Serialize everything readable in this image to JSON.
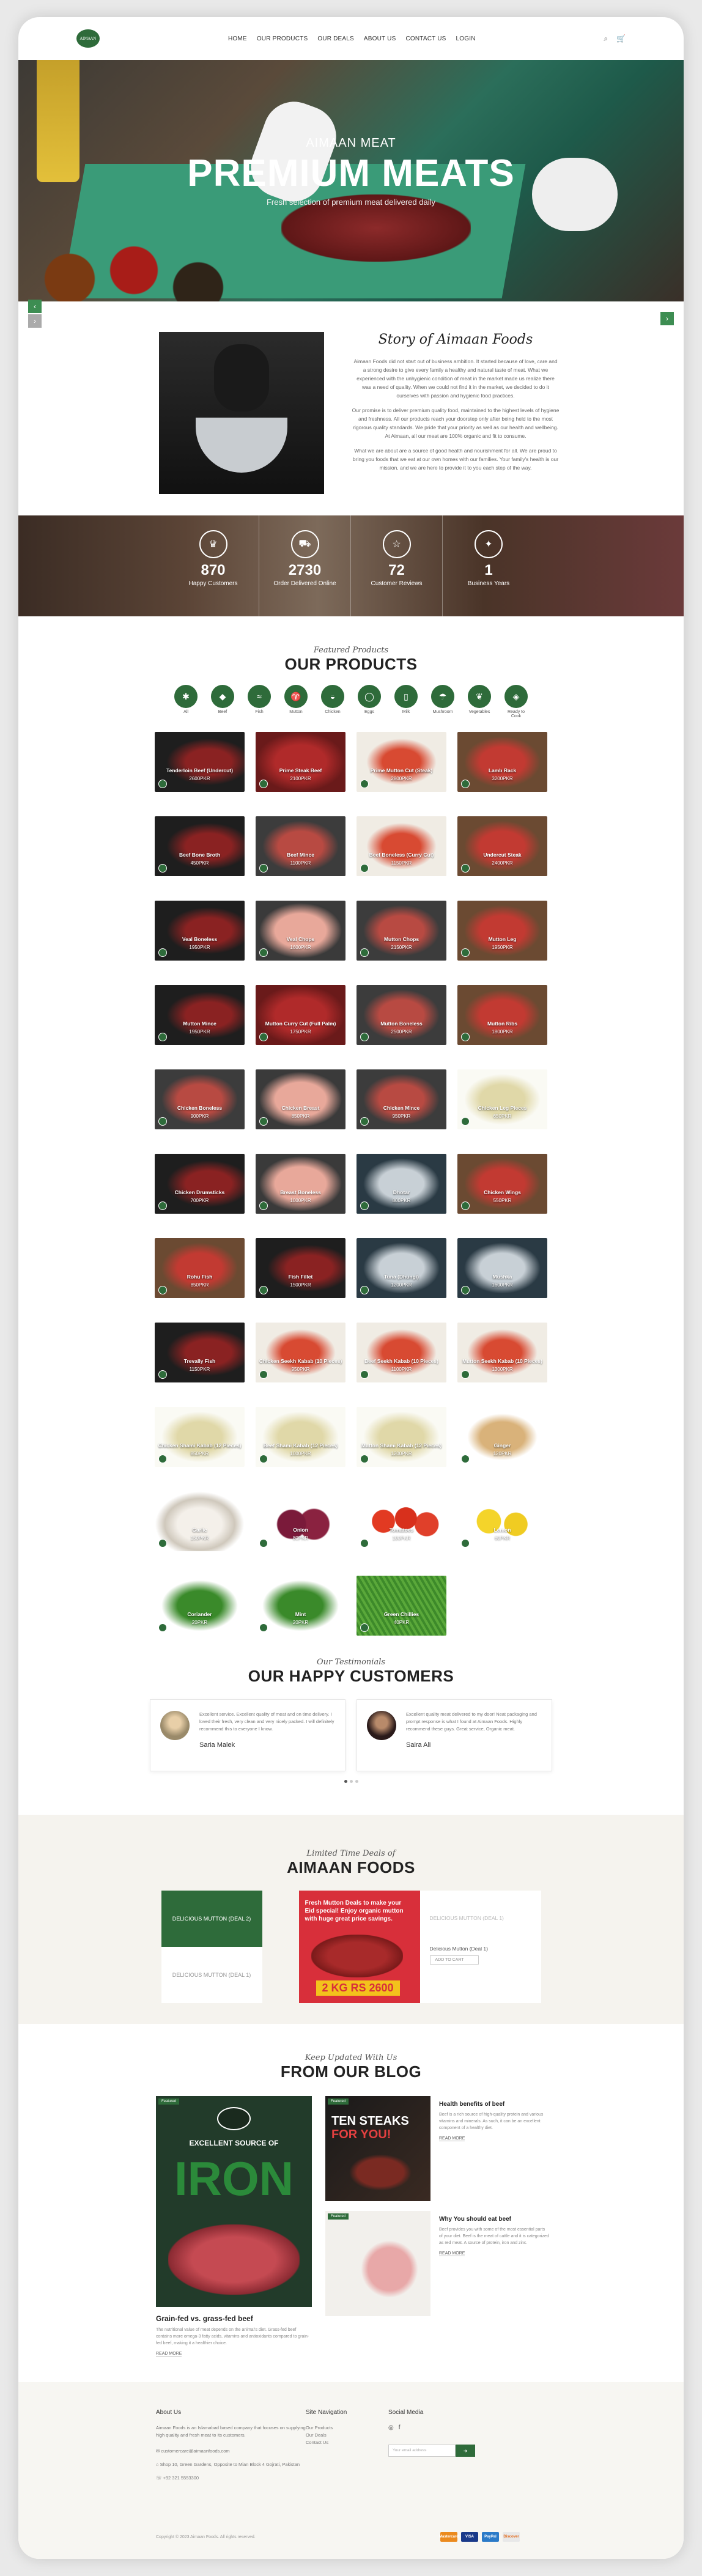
{
  "header": {
    "nav": [
      "HOME",
      "OUR PRODUCTS",
      "OUR DEALS",
      "ABOUT US",
      "CONTACT US",
      "LOGIN"
    ],
    "icons": [
      "search-icon",
      "cart-icon"
    ]
  },
  "hero": {
    "subtitle": "AIMAAN MEAT",
    "title": "PREMIUM MEATS",
    "tagline": "Fresh selection of premium meat delivered daily"
  },
  "story": {
    "title": "Story of Aimaan Foods",
    "paragraphs": [
      "Aimaan Foods did not start out of business ambition. It started because of love, care and a strong desire to give every family a healthy and natural taste of meat. What we experienced with the unhygienic condition of meat in the market made us realize there was a need of quality. When we could not find it in the market, we decided to do it ourselves with passion and hygienic food practices.",
      "Our promise is to deliver premium quality food, maintained to the highest levels of hygiene and freshness. All our products reach your doorstep only after being held to the most rigorous quality standards. We pride that your priority as well as our health and wellbeing. At Aimaan, all our meat are 100% organic and fit to consume.",
      "What we are about are a source of good health and nourishment for all. We are proud to bring you foods that we eat at our own homes with our families. Your family's health is our mission, and we are here to provide it to you each step of the way."
    ]
  },
  "stats": [
    {
      "icon": "crown-icon",
      "number": "870",
      "label": "Happy Customers"
    },
    {
      "icon": "truck-icon",
      "number": "2730",
      "label": "Order Delivered Online"
    },
    {
      "icon": "star-icon",
      "number": "72",
      "label": "Customer Reviews"
    },
    {
      "icon": "trophy-icon",
      "number": "1",
      "label": "Business Years"
    }
  ],
  "products": {
    "script": "Featured Products",
    "title": "OUR PRODUCTS",
    "categories": [
      "All",
      "Beef",
      "Fish",
      "Mutton",
      "Chicken",
      "Eggs",
      "Milk",
      "Mushroom",
      "Vegetables",
      "Ready to Cook"
    ],
    "items": [
      {
        "name": "Tenderloin Beef (Undercut)",
        "price": "2600PKR",
        "bg": "bg-dark"
      },
      {
        "name": "Prime Steak Beef",
        "price": "2100PKR",
        "bg": "bg-red"
      },
      {
        "name": "Prime Mutton Cut (Steak)",
        "price": "2800PKR",
        "bg": "bg-light"
      },
      {
        "name": "Lamb Rack",
        "price": "3200PKR",
        "bg": "bg-wood"
      },
      {
        "name": "Beef Bone Broth",
        "price": "450PKR",
        "bg": "bg-dark"
      },
      {
        "name": "Beef Mince",
        "price": "1100PKR",
        "bg": "bg-gray"
      },
      {
        "name": "Beef Boneless (Curry Cut)",
        "price": "1150PKR",
        "bg": "bg-light"
      },
      {
        "name": "Undercut Steak",
        "price": "2400PKR",
        "bg": "bg-wood"
      },
      {
        "name": "Veal Boneless",
        "price": "1950PKR",
        "bg": "bg-dark"
      },
      {
        "name": "Veal Chops",
        "price": "1600PKR",
        "bg": "bg-pink"
      },
      {
        "name": "Mutton Chops",
        "price": "2150PKR",
        "bg": "bg-gray"
      },
      {
        "name": "Mutton Leg",
        "price": "1950PKR",
        "bg": "bg-wood"
      },
      {
        "name": "Mutton Mince",
        "price": "1950PKR",
        "bg": "bg-dark"
      },
      {
        "name": "Mutton Curry Cut (Full Palm)",
        "price": "1750PKR",
        "bg": "bg-red"
      },
      {
        "name": "Mutton Boneless",
        "price": "2500PKR",
        "bg": "bg-gray"
      },
      {
        "name": "Mutton Ribs",
        "price": "1800PKR",
        "bg": "bg-wood"
      },
      {
        "name": "Chicken Boneless",
        "price": "900PKR",
        "bg": "bg-gray"
      },
      {
        "name": "Chicken Breast",
        "price": "850PKR",
        "bg": "bg-pink"
      },
      {
        "name": "Chicken Mince",
        "price": "950PKR",
        "bg": "bg-gray"
      },
      {
        "name": "Chicken Leg Pieces",
        "price": "650PKR",
        "bg": "bg-veg"
      },
      {
        "name": "Chicken Drumsticks",
        "price": "700PKR",
        "bg": "bg-dark"
      },
      {
        "name": "Breast Boneless",
        "price": "1000PKR",
        "bg": "bg-pink"
      },
      {
        "name": "Dhotar",
        "price": "800PKR",
        "bg": "bg-fish"
      },
      {
        "name": "Chicken Wings",
        "price": "550PKR",
        "bg": "bg-wood"
      },
      {
        "name": "Rohu Fish",
        "price": "850PKR",
        "bg": "bg-wood"
      },
      {
        "name": "Fish Fillet",
        "price": "1500PKR",
        "bg": "bg-dark"
      },
      {
        "name": "Tuna (Dhungi)",
        "price": "1200PKR",
        "bg": "bg-fish"
      },
      {
        "name": "Mushka",
        "price": "1600PKR",
        "bg": "bg-fish"
      },
      {
        "name": "Trevally Fish",
        "price": "1150PKR",
        "bg": "bg-dark"
      },
      {
        "name": "Chicken Seekh Kabab (10 Pieces)",
        "price": "950PKR",
        "bg": "bg-light"
      },
      {
        "name": "Beef Seekh Kabab (10 Pieces)",
        "price": "1100PKR",
        "bg": "bg-light"
      },
      {
        "name": "Mutton Seekh Kabab (10 Pieces)",
        "price": "1300PKR",
        "bg": "bg-light"
      },
      {
        "name": "Chicken Shami Kabab (12 Pieces)",
        "price": "850PKR",
        "bg": "bg-veg"
      },
      {
        "name": "Beef Shami Kabab (12 Pieces)",
        "price": "1000PKR",
        "bg": "bg-veg"
      },
      {
        "name": "Mutton Shami Kabab (12 Pieces)",
        "price": "1200PKR",
        "bg": "bg-veg"
      },
      {
        "name": "Ginger",
        "price": "120PKR",
        "bg": "bg-ginger"
      },
      {
        "name": "Garlic",
        "price": "150PKR",
        "bg": "bg-garlic"
      },
      {
        "name": "Onion",
        "price": "80PKR",
        "bg": "bg-onion"
      },
      {
        "name": "Tomatoes",
        "price": "100PKR",
        "bg": "bg-tomato"
      },
      {
        "name": "Lemon",
        "price": "60PKR",
        "bg": "bg-lemon"
      },
      {
        "name": "Coriander",
        "price": "20PKR",
        "bg": "bg-herb"
      },
      {
        "name": "Mint",
        "price": "20PKR",
        "bg": "bg-herb"
      },
      {
        "name": "Green Chillies",
        "price": "40PKR",
        "bg": "bg-beans"
      }
    ]
  },
  "testimonials": {
    "script": "Our Testimonials",
    "title": "OUR HAPPY CUSTOMERS",
    "items": [
      {
        "text": "Excellent service. Excellent quality of meat and on time delivery. I loved their fresh, very clean and very nicely packed. I will definitely recommend this to everyone I know.",
        "name": "Saria Malek"
      },
      {
        "text": "Excellent quality meat delivered to my door! Neat packaging and prompt response is what I found at Aimaan Foods. Highly recommend these guys. Great service, Organic meat.",
        "name": "Saira Ali"
      }
    ]
  },
  "deals": {
    "script": "Limited Time Deals of",
    "title": "AIMAAN FOODS",
    "left_top": "DELICIOUS MUTTON (DEAL 2)",
    "left_bottom": "DELICIOUS MUTTON (DEAL 1)",
    "banner": "Fresh Mutton Deals to make your Eid special! Enjoy organic mutton with huge great price savings.",
    "price": "2 KG RS 2600",
    "right_top": "DELICIOUS MUTTON (DEAL 1)",
    "right_name": "Delicious Mutton (Deal 1)",
    "right_button": "ADD TO CART"
  },
  "blog": {
    "script": "Keep Updated With Us",
    "title": "FROM OUR BLOG",
    "main": {
      "tag": "Featured",
      "excellent": "EXCELLENT SOURCE OF",
      "iron": "IRON",
      "title": "Grain-fed vs. grass-fed beef",
      "excerpt": "The nutritional value of meat depends on the animal's diet. Grass-fed beef contains more omega-3 fatty acids, vitamins and antioxidants compared to grain-fed beef, making it a healthier choice.",
      "more": "READ MORE"
    },
    "side": [
      {
        "tag": "Featured",
        "w1": "TEN STEAKS",
        "w2": "FOR YOU!",
        "title": "Health benefits of beef",
        "excerpt": "Beef is a rich source of high-quality protein and various vitamins and minerals. As such, it can be an excellent component of a healthy diet.",
        "more": "READ MORE"
      },
      {
        "tag": "Featured",
        "title": "Why You should eat beef",
        "excerpt": "Beef provides you with some of the most essential parts of your diet. Beef is the meat of cattle and it is categorized as red meat. A source of protein, iron and zinc.",
        "more": "READ MORE"
      }
    ]
  },
  "footer": {
    "about_title": "About Us",
    "about_text": "Aimaan Foods is an Islamabad based company that focuses on supplying high quality and fresh meat to its customers.",
    "email": "customercare@aimaanfoods.com",
    "address": "Shop 10, Green Gardens, Opposite to Mian Block 4 Gojrati, Pakistan",
    "phone": "+92 321 5553300",
    "nav_title": "Site Navigation",
    "nav_items": [
      "Our Products",
      "Our Deals",
      "Contact Us"
    ],
    "social_title": "Social Media",
    "social_icons": [
      "instagram-icon",
      "facebook-icon"
    ],
    "subscribe_placeholder": "Your email address",
    "subscribe_button": "➜",
    "copyright": "Copyright © 2023 Aimaan Foods. All rights reserved.",
    "payments": [
      "Mastercard",
      "VISA",
      "PayPal",
      "Discover"
    ]
  }
}
